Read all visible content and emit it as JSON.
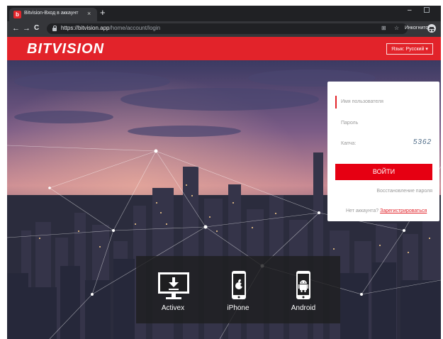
{
  "browser": {
    "tab_title": "Bitvision-Вход в аккаунт",
    "favicon_letter": "b",
    "tab_close": "×",
    "new_tab": "+",
    "window_minimize": "–",
    "back": "←",
    "forward": "→",
    "reload": "C",
    "url_host": "https://bitvision.app",
    "url_path": "/home/account/login",
    "translate_icon": "⊞",
    "bookmark_icon": "☆",
    "incognito_label": "Инкогнито"
  },
  "header": {
    "logo": "BITVISION",
    "language_button": "Язык: Русский"
  },
  "login": {
    "username_placeholder": "Имя пользователя",
    "password_placeholder": "Пароль",
    "captcha_placeholder": "Капча:",
    "captcha_text": "5362",
    "submit_label": "ВОЙТИ",
    "recover_label": "Восстановление пароля",
    "no_account_text": "Нет аккаунта?",
    "register_label": "Зарегистрироваться"
  },
  "downloads": [
    {
      "label": "Activex",
      "icon": "monitor-download-icon"
    },
    {
      "label": "iPhone",
      "icon": "apple-phone-icon"
    },
    {
      "label": "Android",
      "icon": "android-phone-icon"
    }
  ],
  "colors": {
    "brand_red": "#e2232a",
    "button_red": "#e60012",
    "chrome_dark": "#202124",
    "chrome_toolbar": "#35363a"
  }
}
